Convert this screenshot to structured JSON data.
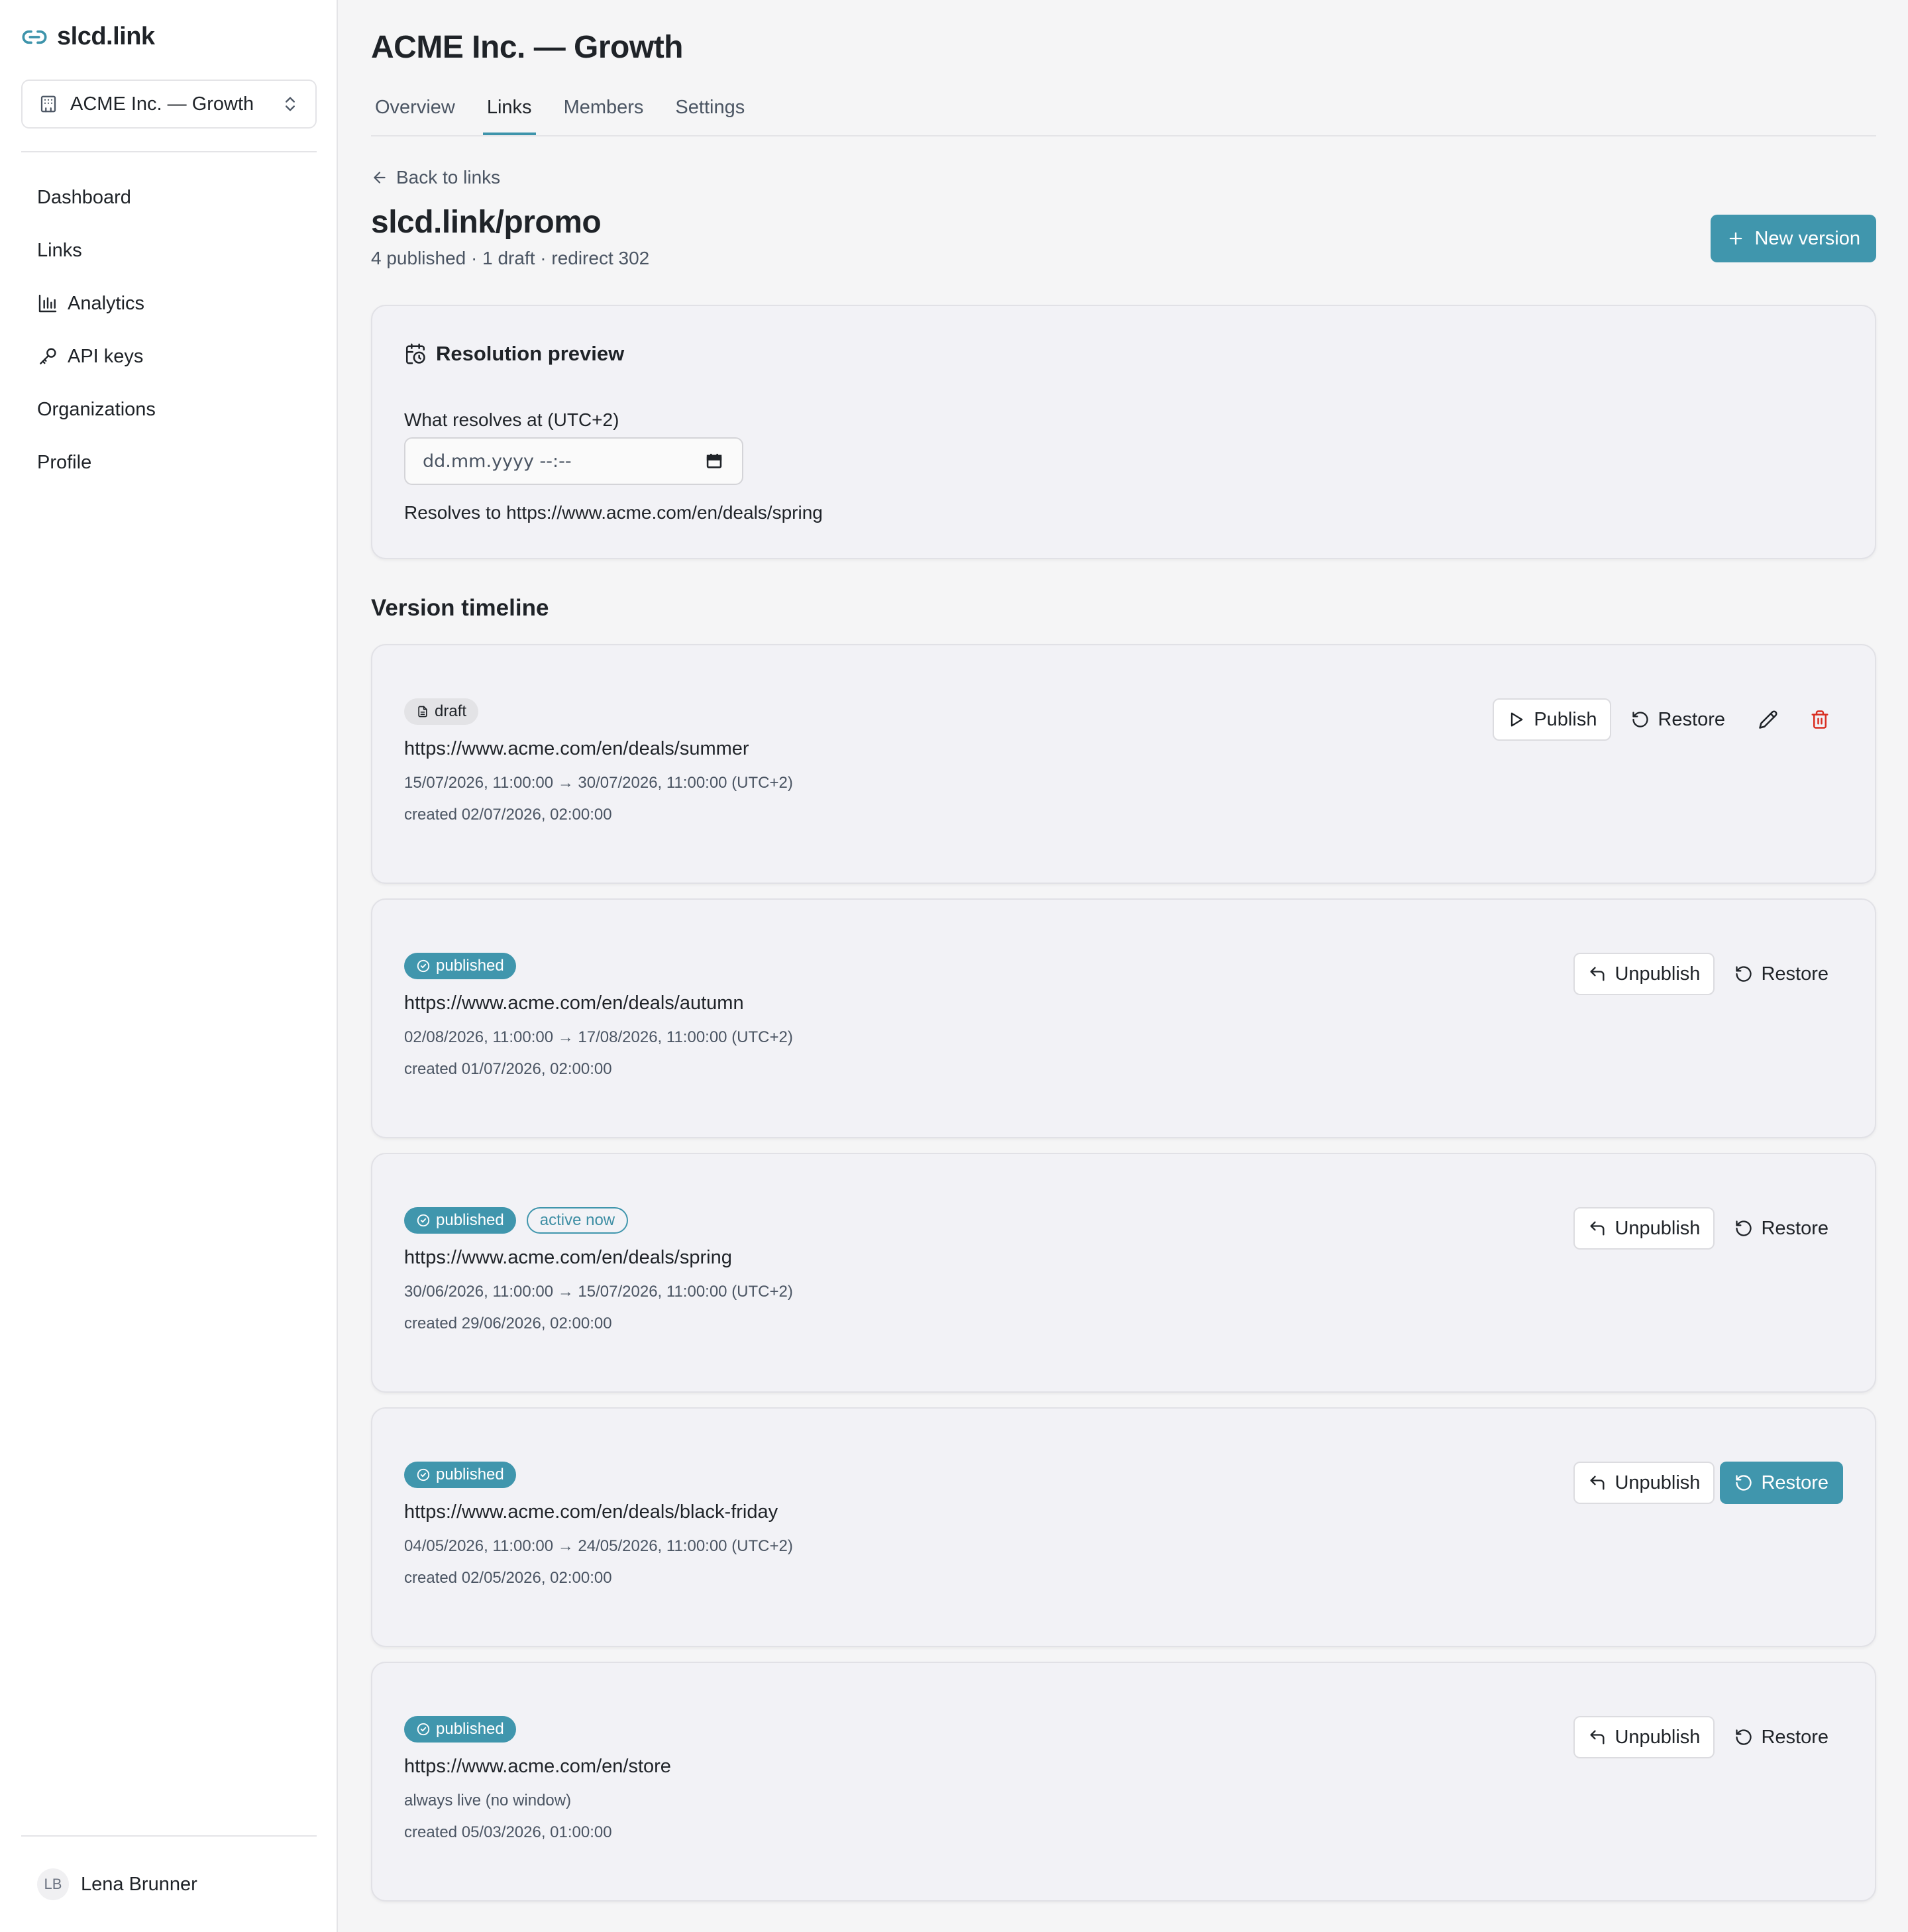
{
  "brand": {
    "name": "slcd.link",
    "accent": "#4096ad",
    "danger": "#d92d20"
  },
  "org_switcher": {
    "label": "ACME Inc. — Growth"
  },
  "sidebar": {
    "items": [
      {
        "label": "Dashboard",
        "icon": ""
      },
      {
        "label": "Links",
        "icon": ""
      },
      {
        "label": "Analytics",
        "icon": "bar-chart-icon"
      },
      {
        "label": "API keys",
        "icon": "key-icon"
      },
      {
        "label": "Organizations",
        "icon": ""
      },
      {
        "label": "Profile",
        "icon": ""
      }
    ]
  },
  "user": {
    "initials": "LB",
    "name": "Lena Brunner"
  },
  "header": {
    "title": "ACME Inc. — Growth",
    "tabs": [
      {
        "label": "Overview",
        "active": false
      },
      {
        "label": "Links",
        "active": true
      },
      {
        "label": "Members",
        "active": false
      },
      {
        "label": "Settings",
        "active": false
      }
    ]
  },
  "link": {
    "back_label": "Back to links",
    "title": "slcd.link/promo",
    "meta": "4 published · 1 draft · redirect 302",
    "new_version_label": "New version"
  },
  "preview": {
    "title": "Resolution preview",
    "field_label": "What resolves at (UTC+2)",
    "input_placeholder": "dd.mm.yyyy --:--",
    "resolves_prefix": "Resolves to",
    "resolves_url": "https://www.acme.com/en/deals/spring"
  },
  "timeline": {
    "title": "Version timeline",
    "versions": [
      {
        "status": "draft",
        "active_badge": "",
        "url": "https://www.acme.com/en/deals/summer",
        "window": "15/07/2026, 11:00:00 → 30/07/2026, 11:00:00 (UTC+2)",
        "created": "created 02/07/2026, 02:00:00",
        "actions": [
          "Publish",
          "Restore"
        ]
      },
      {
        "status": "published",
        "active_badge": "",
        "url": "https://www.acme.com/en/deals/autumn",
        "window": "02/08/2026, 11:00:00 → 17/08/2026, 11:00:00 (UTC+2)",
        "created": "created 01/07/2026, 02:00:00",
        "actions": [
          "Unpublish",
          "Restore"
        ]
      },
      {
        "status": "published",
        "active_badge": "active now",
        "url": "https://www.acme.com/en/deals/spring",
        "window": "30/06/2026, 11:00:00 → 15/07/2026, 11:00:00 (UTC+2)",
        "created": "created 29/06/2026, 02:00:00",
        "actions": [
          "Unpublish",
          "Restore"
        ]
      },
      {
        "status": "published",
        "active_badge": "",
        "url": "https://www.acme.com/en/deals/black-friday",
        "window": "04/05/2026, 11:00:00 → 24/05/2026, 11:00:00 (UTC+2)",
        "created": "created 02/05/2026, 02:00:00",
        "actions": [
          "Unpublish",
          "Restore"
        ]
      },
      {
        "status": "published",
        "active_badge": "",
        "url": "https://www.acme.com/en/store",
        "window": "always live (no window)",
        "created": "created 05/03/2026, 01:00:00",
        "actions": [
          "Unpublish",
          "Restore"
        ]
      }
    ]
  }
}
